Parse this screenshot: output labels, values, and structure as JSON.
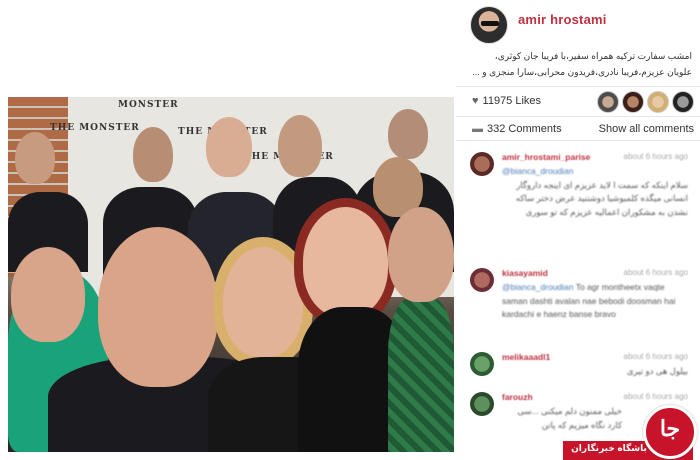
{
  "post": {
    "username": "amir  hrostami",
    "caption": "امشب سفارت ترکیه همراه سفیر،با فریبا جان کوثری، علویان عزیزم،فریبا نادری،فریدون محرابی،سارا منجزی و ...",
    "photo_backdrop_text": [
      "THE MONSTER",
      "THE MONSTER",
      "THE MONSTER",
      "MONSTER"
    ]
  },
  "stats": {
    "likes": "11975 Likes",
    "comments": "332 Comments",
    "show_all": "Show all comments"
  },
  "comments": [
    {
      "user": "amir_hrostami_parise",
      "time": "about 6 hours ago",
      "mention": "@bianca_droudian",
      "text": "سلام اینکه که سمت ا لاید عزیزم ای اینجه داروگار انسانی میگذه کلمبوشیا دوشتنید عرض دختر ساکه نشدن به مشکوران اعمالیه عزیزم که تو سوری"
    },
    {
      "user": "kiasayamid",
      "time": "about 6 hours ago",
      "mention": "@bianca_droudian",
      "text": "To agr montheetx vaqte saman dashti avalan nae bebodi doosman hai kardachi e haenz banse bravo"
    },
    {
      "user": "melikaaadl1",
      "time": "about 6 hours ago",
      "mention": "",
      "text": "بیلول هی دو تیری"
    },
    {
      "user": "farouzh",
      "time": "about 6 hours ago",
      "mention": "",
      "text": "خیلی ممنون دلم میکنی ...سی کارد نگاه میزیم که پاتن"
    }
  ],
  "watermark": {
    "text": "باشگاه خبرنگاران",
    "logo_glyph": "جا"
  },
  "colors": {
    "username": "#c0303f",
    "mention": "#4a7bb7",
    "watermark": "#c8142a"
  },
  "icons": {
    "likes": "heart-icon",
    "comments": "speech-bubble-icon"
  }
}
